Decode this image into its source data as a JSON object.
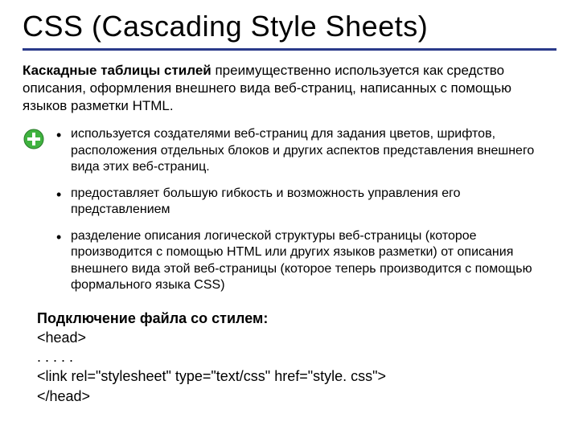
{
  "title": "CSS (Cascading Style Sheets)",
  "intro_bold": "Каскадные таблицы стилей",
  "intro_rest": " преимущественно используется как средство описания, оформления внешнего вида веб-страниц, написанных с помощью языков разметки HTML.",
  "bullets": [
    "используется создателями веб-страниц для задания цветов, шрифтов, расположения отдельных блоков и других аспектов представления внешнего вида этих веб-страниц.",
    "предоставляет большую гибкость и возможность управления его представлением",
    "разделение описания логической структуры веб-страницы (которое производится с помощью HTML или других языков разметки) от описания внешнего вида этой веб-страницы (которое теперь производится с помощью формального языка CSS)"
  ],
  "connect": {
    "header": "Подключение файла со стилем:",
    "line1": "<head>",
    "line2": ". . . . .",
    "line3": "<link rel=\"stylesheet\" type=\"text/css\" href=\"style. css\">",
    "line4": "</head>"
  }
}
